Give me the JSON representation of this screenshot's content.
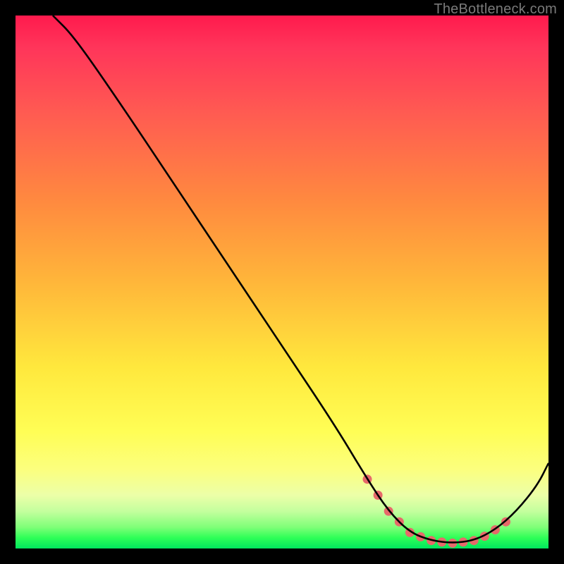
{
  "watermark": {
    "text": "TheBottleneck.com"
  },
  "chart_data": {
    "type": "line",
    "title": "",
    "xlabel": "",
    "ylabel": "",
    "xlim": [
      0,
      100
    ],
    "ylim": [
      0,
      100
    ],
    "series": [
      {
        "name": "curve",
        "x": [
          7,
          11,
          20,
          30,
          40,
          50,
          60,
          66,
          70,
          74,
          78,
          82,
          86,
          90,
          94,
          98,
          100
        ],
        "y": [
          100,
          96,
          83,
          68,
          53,
          38,
          23,
          13,
          7,
          3,
          1.5,
          1.0,
          1.5,
          3.5,
          7,
          12,
          16
        ]
      }
    ],
    "dots": {
      "name": "highlight-dots",
      "x": [
        66,
        68,
        70,
        72,
        74,
        76,
        78,
        80,
        82,
        84,
        86,
        88,
        90,
        92
      ],
      "y": [
        13,
        10,
        7,
        5,
        3,
        2.2,
        1.5,
        1.2,
        1.0,
        1.2,
        1.5,
        2.3,
        3.5,
        5
      ]
    },
    "colors": {
      "line": "#000000",
      "dots": "#e66a6a"
    }
  }
}
